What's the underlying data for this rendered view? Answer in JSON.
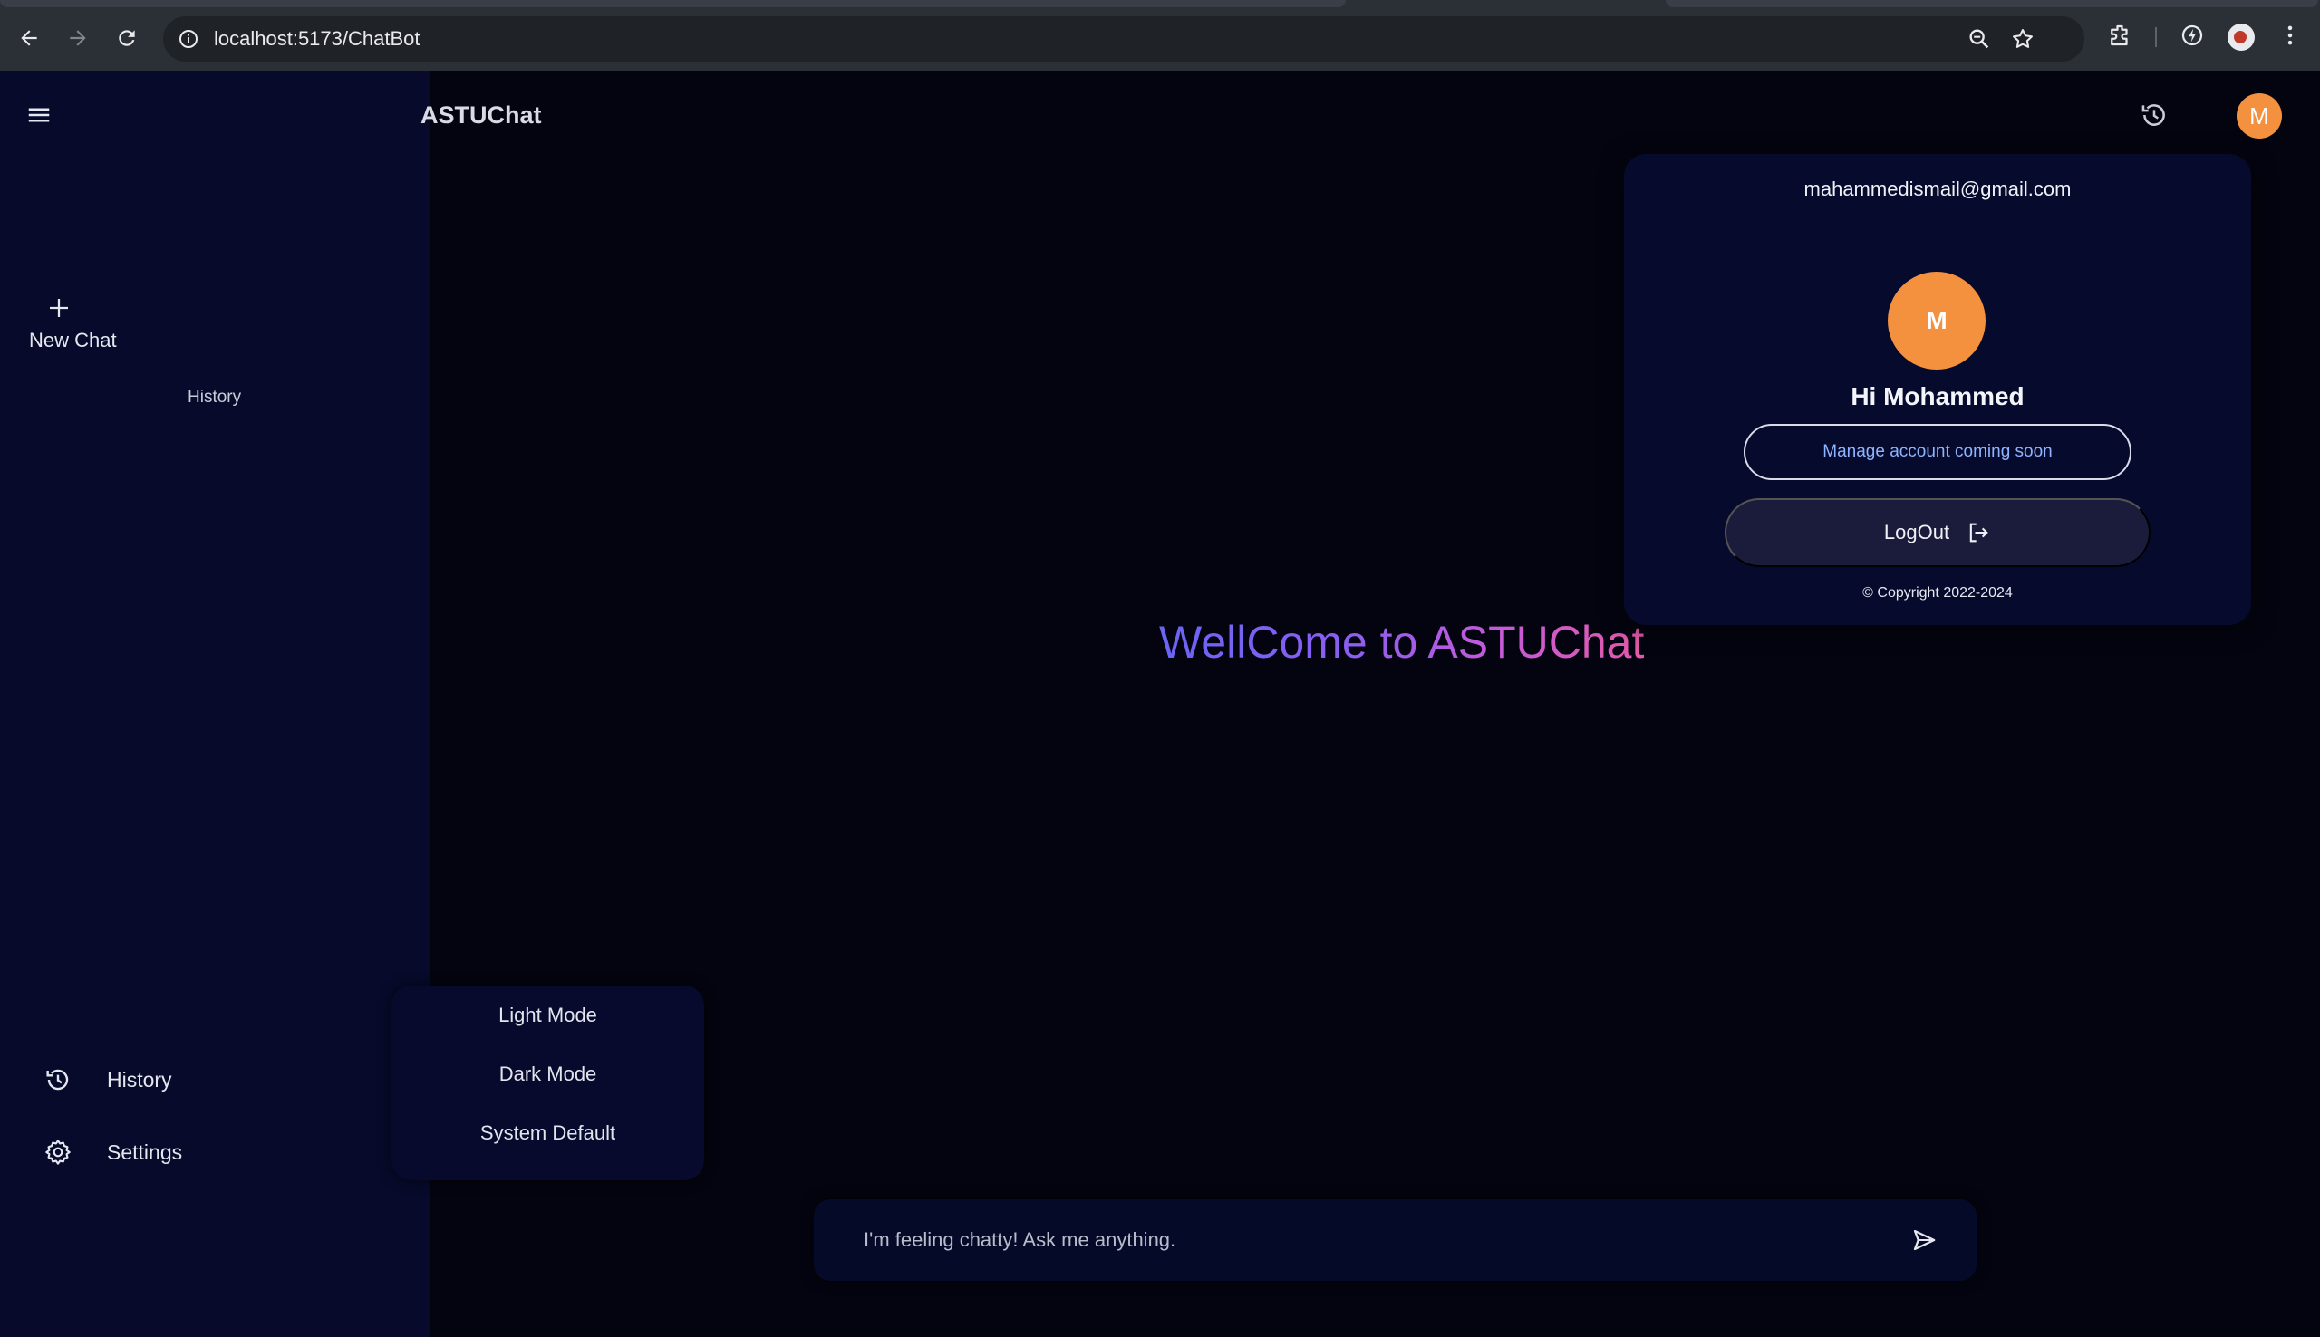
{
  "browser": {
    "url": "localhost:5173/ChatBot"
  },
  "sidebar": {
    "new_chat_label": "New Chat",
    "history_label": "History",
    "items": [
      {
        "label": "History",
        "icon": "history-icon"
      },
      {
        "label": "Settings",
        "icon": "gear-icon"
      }
    ]
  },
  "header": {
    "brand": "ASTUChat",
    "avatar_initial": "M"
  },
  "main": {
    "welcome": "WellCome to ASTUChat"
  },
  "account": {
    "email": "mahammedismail@gmail.com",
    "avatar_initial": "M",
    "greeting": "Hi Mohammed",
    "manage_label": "Manage account coming soon",
    "logout_label": "LogOut",
    "copyright": "© Copyright 2022-2024"
  },
  "theme_menu": {
    "options": [
      "Light Mode",
      "Dark Mode",
      "System Default"
    ]
  },
  "prompt": {
    "placeholder": "I'm feeling chatty! Ask me anything."
  },
  "colors": {
    "accent_orange": "#f4913f",
    "sidebar_bg": "#070a2a",
    "page_bg": "#03040f",
    "gradient_start": "#6a64f4",
    "gradient_end": "#e35aa8"
  }
}
